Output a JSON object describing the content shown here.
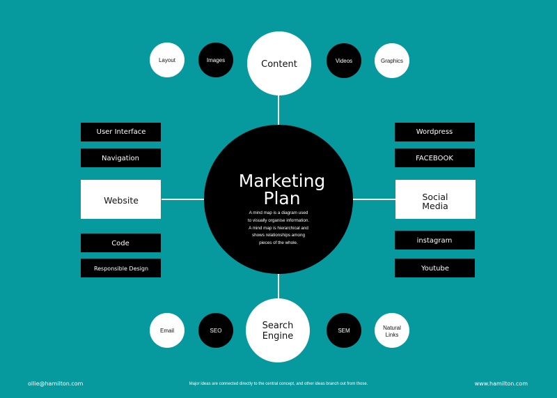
{
  "colors": {
    "background": "#06999d",
    "primary_fill": "#000000",
    "secondary_fill": "#ffffff",
    "connector": "#ffffff"
  },
  "center": {
    "title_lines": [
      "Marketing",
      "Plan"
    ],
    "description_lines": [
      "A mind map is a diagram used",
      "to visually organise information.",
      "A mind map is hierarchical and",
      "shows relationships among",
      "pieces of the whole."
    ]
  },
  "branches": {
    "top": {
      "major": "Content",
      "sub_left": [
        "Layout",
        "Images"
      ],
      "sub_right": [
        "Videos",
        "Graphics"
      ]
    },
    "bottom": {
      "major_lines": [
        "Search",
        "Engine"
      ],
      "sub_left": [
        "Email",
        "SEO"
      ],
      "sub_right": [
        "SEM",
        "Natural Links"
      ],
      "natural_links_lines": [
        "Natural",
        "Links"
      ]
    },
    "left": {
      "major": "Website",
      "sub_top": [
        "User Interface",
        "Navigation"
      ],
      "sub_bottom": [
        "Code",
        "Responsible Design"
      ]
    },
    "right": {
      "major_lines": [
        "Social",
        "Media"
      ],
      "sub_top": [
        "Wordpress",
        "FACEBOOK"
      ],
      "sub_bottom": [
        "instagram",
        "Youtube"
      ]
    }
  },
  "footer": {
    "email": "ollie@hamilton.com",
    "note": "Major ideas are connected directly to the central concept, and other ideas branch out from those.",
    "website": "www.hamilton.com"
  }
}
